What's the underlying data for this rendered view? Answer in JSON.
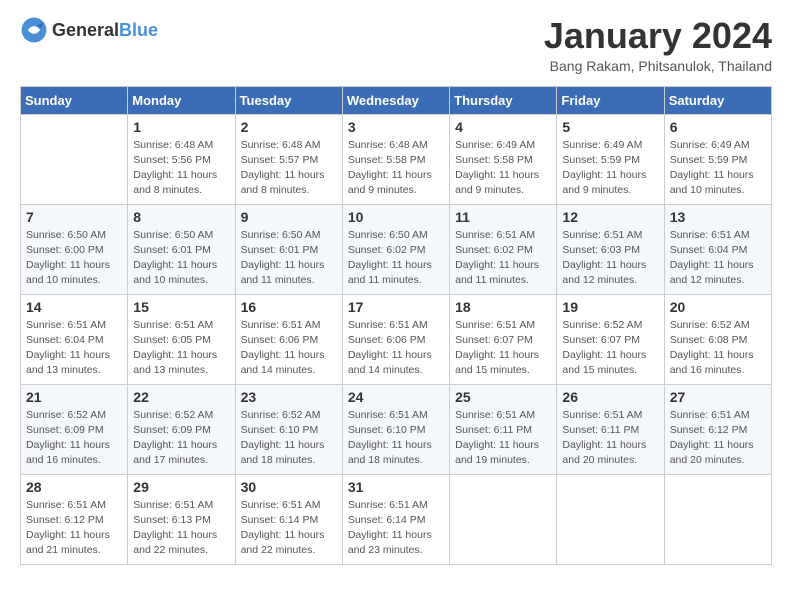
{
  "header": {
    "logo_general": "General",
    "logo_blue": "Blue",
    "title": "January 2024",
    "subtitle": "Bang Rakam, Phitsanulok, Thailand"
  },
  "weekdays": [
    "Sunday",
    "Monday",
    "Tuesday",
    "Wednesday",
    "Thursday",
    "Friday",
    "Saturday"
  ],
  "weeks": [
    [
      {
        "day": "",
        "sunrise": "",
        "sunset": "",
        "daylight": ""
      },
      {
        "day": "1",
        "sunrise": "Sunrise: 6:48 AM",
        "sunset": "Sunset: 5:56 PM",
        "daylight": "Daylight: 11 hours and 8 minutes."
      },
      {
        "day": "2",
        "sunrise": "Sunrise: 6:48 AM",
        "sunset": "Sunset: 5:57 PM",
        "daylight": "Daylight: 11 hours and 8 minutes."
      },
      {
        "day": "3",
        "sunrise": "Sunrise: 6:48 AM",
        "sunset": "Sunset: 5:58 PM",
        "daylight": "Daylight: 11 hours and 9 minutes."
      },
      {
        "day": "4",
        "sunrise": "Sunrise: 6:49 AM",
        "sunset": "Sunset: 5:58 PM",
        "daylight": "Daylight: 11 hours and 9 minutes."
      },
      {
        "day": "5",
        "sunrise": "Sunrise: 6:49 AM",
        "sunset": "Sunset: 5:59 PM",
        "daylight": "Daylight: 11 hours and 9 minutes."
      },
      {
        "day": "6",
        "sunrise": "Sunrise: 6:49 AM",
        "sunset": "Sunset: 5:59 PM",
        "daylight": "Daylight: 11 hours and 10 minutes."
      }
    ],
    [
      {
        "day": "7",
        "sunrise": "Sunrise: 6:50 AM",
        "sunset": "Sunset: 6:00 PM",
        "daylight": "Daylight: 11 hours and 10 minutes."
      },
      {
        "day": "8",
        "sunrise": "Sunrise: 6:50 AM",
        "sunset": "Sunset: 6:01 PM",
        "daylight": "Daylight: 11 hours and 10 minutes."
      },
      {
        "day": "9",
        "sunrise": "Sunrise: 6:50 AM",
        "sunset": "Sunset: 6:01 PM",
        "daylight": "Daylight: 11 hours and 11 minutes."
      },
      {
        "day": "10",
        "sunrise": "Sunrise: 6:50 AM",
        "sunset": "Sunset: 6:02 PM",
        "daylight": "Daylight: 11 hours and 11 minutes."
      },
      {
        "day": "11",
        "sunrise": "Sunrise: 6:51 AM",
        "sunset": "Sunset: 6:02 PM",
        "daylight": "Daylight: 11 hours and 11 minutes."
      },
      {
        "day": "12",
        "sunrise": "Sunrise: 6:51 AM",
        "sunset": "Sunset: 6:03 PM",
        "daylight": "Daylight: 11 hours and 12 minutes."
      },
      {
        "day": "13",
        "sunrise": "Sunrise: 6:51 AM",
        "sunset": "Sunset: 6:04 PM",
        "daylight": "Daylight: 11 hours and 12 minutes."
      }
    ],
    [
      {
        "day": "14",
        "sunrise": "Sunrise: 6:51 AM",
        "sunset": "Sunset: 6:04 PM",
        "daylight": "Daylight: 11 hours and 13 minutes."
      },
      {
        "day": "15",
        "sunrise": "Sunrise: 6:51 AM",
        "sunset": "Sunset: 6:05 PM",
        "daylight": "Daylight: 11 hours and 13 minutes."
      },
      {
        "day": "16",
        "sunrise": "Sunrise: 6:51 AM",
        "sunset": "Sunset: 6:06 PM",
        "daylight": "Daylight: 11 hours and 14 minutes."
      },
      {
        "day": "17",
        "sunrise": "Sunrise: 6:51 AM",
        "sunset": "Sunset: 6:06 PM",
        "daylight": "Daylight: 11 hours and 14 minutes."
      },
      {
        "day": "18",
        "sunrise": "Sunrise: 6:51 AM",
        "sunset": "Sunset: 6:07 PM",
        "daylight": "Daylight: 11 hours and 15 minutes."
      },
      {
        "day": "19",
        "sunrise": "Sunrise: 6:52 AM",
        "sunset": "Sunset: 6:07 PM",
        "daylight": "Daylight: 11 hours and 15 minutes."
      },
      {
        "day": "20",
        "sunrise": "Sunrise: 6:52 AM",
        "sunset": "Sunset: 6:08 PM",
        "daylight": "Daylight: 11 hours and 16 minutes."
      }
    ],
    [
      {
        "day": "21",
        "sunrise": "Sunrise: 6:52 AM",
        "sunset": "Sunset: 6:09 PM",
        "daylight": "Daylight: 11 hours and 16 minutes."
      },
      {
        "day": "22",
        "sunrise": "Sunrise: 6:52 AM",
        "sunset": "Sunset: 6:09 PM",
        "daylight": "Daylight: 11 hours and 17 minutes."
      },
      {
        "day": "23",
        "sunrise": "Sunrise: 6:52 AM",
        "sunset": "Sunset: 6:10 PM",
        "daylight": "Daylight: 11 hours and 18 minutes."
      },
      {
        "day": "24",
        "sunrise": "Sunrise: 6:51 AM",
        "sunset": "Sunset: 6:10 PM",
        "daylight": "Daylight: 11 hours and 18 minutes."
      },
      {
        "day": "25",
        "sunrise": "Sunrise: 6:51 AM",
        "sunset": "Sunset: 6:11 PM",
        "daylight": "Daylight: 11 hours and 19 minutes."
      },
      {
        "day": "26",
        "sunrise": "Sunrise: 6:51 AM",
        "sunset": "Sunset: 6:11 PM",
        "daylight": "Daylight: 11 hours and 20 minutes."
      },
      {
        "day": "27",
        "sunrise": "Sunrise: 6:51 AM",
        "sunset": "Sunset: 6:12 PM",
        "daylight": "Daylight: 11 hours and 20 minutes."
      }
    ],
    [
      {
        "day": "28",
        "sunrise": "Sunrise: 6:51 AM",
        "sunset": "Sunset: 6:12 PM",
        "daylight": "Daylight: 11 hours and 21 minutes."
      },
      {
        "day": "29",
        "sunrise": "Sunrise: 6:51 AM",
        "sunset": "Sunset: 6:13 PM",
        "daylight": "Daylight: 11 hours and 22 minutes."
      },
      {
        "day": "30",
        "sunrise": "Sunrise: 6:51 AM",
        "sunset": "Sunset: 6:14 PM",
        "daylight": "Daylight: 11 hours and 22 minutes."
      },
      {
        "day": "31",
        "sunrise": "Sunrise: 6:51 AM",
        "sunset": "Sunset: 6:14 PM",
        "daylight": "Daylight: 11 hours and 23 minutes."
      },
      {
        "day": "",
        "sunrise": "",
        "sunset": "",
        "daylight": ""
      },
      {
        "day": "",
        "sunrise": "",
        "sunset": "",
        "daylight": ""
      },
      {
        "day": "",
        "sunrise": "",
        "sunset": "",
        "daylight": ""
      }
    ]
  ]
}
